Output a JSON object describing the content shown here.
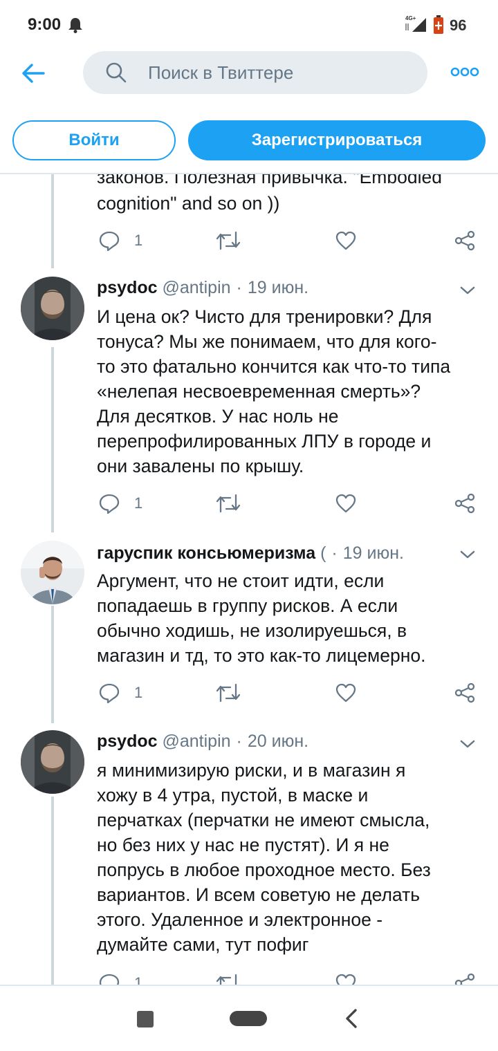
{
  "status_bar": {
    "time": "9:00",
    "network_label": "4G+",
    "battery_level": "96",
    "icons": [
      "bell-icon",
      "signal-icon",
      "battery-icon"
    ]
  },
  "header": {
    "search_placeholder": "Поиск в Твиттере",
    "back_icon": "arrow-left-icon",
    "more_icon": "more-dots-icon",
    "accent_color": "#1da1f2"
  },
  "auth": {
    "login_label": "Войти",
    "signup_label": "Зарегистрироваться"
  },
  "partial_tweet": {
    "text_cut": "законов. Полезная привычка. \"Embodied",
    "text": "cognition\" and so on ))",
    "replies": "1"
  },
  "tweets": [
    {
      "name": "psydoc",
      "handle": "@antipin",
      "date": "19 июн.",
      "text": "И цена ок? Чисто для тренировки? Для\nтонуса? Мы же понимаем, что для кого-\nто это фатально кончится как что-то типа\n«нелепая несвоевременная смерть»?\nДля десятков. У нас ноль не\nперепрофилированных ЛПУ в городе и\nони завалены по крышу.",
      "replies": "1"
    },
    {
      "name": "гаруспик консьюмеризма",
      "handle": "(",
      "date": "19 июн.",
      "text": "Аргумент, что не стоит идти, если\nпопадаешь в группу рисков. А если\nобычно ходишь, не изолируешься, в\nмагазин и тд, то это как-то лицемерно.",
      "replies": "1"
    },
    {
      "name": "psydoc",
      "handle": "@antipin",
      "date": "20 июн.",
      "text": "я минимизирую риски, и в магазин я\nхожу в 4 утра, пустой, в маске и\nперчатках (перчатки не имеют смысла,\nно без них у нас не пустят). И я не\nпопрусь в любое проходное место. Без\nвариантов. И всем советую не делать\nэтого. Удаленное и электронное -\nдумайте сами, тут пофиг",
      "replies": "1"
    }
  ]
}
